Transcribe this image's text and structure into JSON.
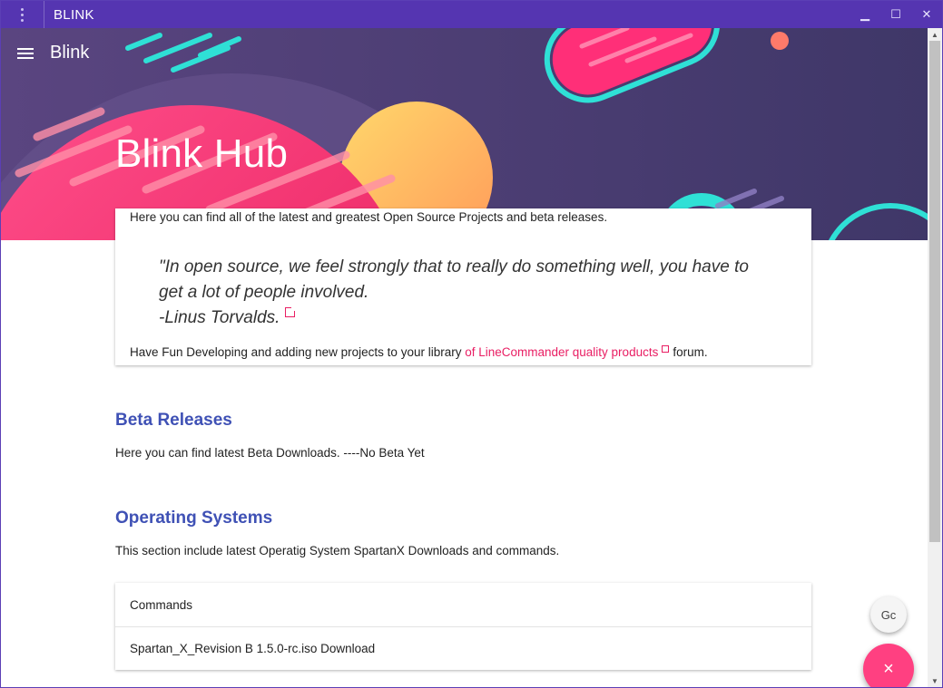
{
  "window": {
    "title": "BLINK",
    "minimize_glyph": "▁",
    "maximize_glyph": "☐",
    "close_glyph": "✕"
  },
  "nav": {
    "brand": "Blink"
  },
  "hero": {
    "title": "Blink Hub"
  },
  "intro": {
    "text": "Here you can find all of the latest and greatest Open Source Projects and beta releases.",
    "quote_line1": "\"In open source, we feel strongly that to really do something well, you have to",
    "quote_line2": "get a lot of people involved.",
    "quote_author": "-Linus Torvalds.",
    "closing_prefix": "Have Fun Developing and adding new projects to your library ",
    "closing_link": "of LineCommander quality products",
    "closing_suffix": "forum."
  },
  "beta": {
    "heading": "Beta Releases",
    "text": "Here you can find latest Beta Downloads. ----No Beta Yet"
  },
  "os": {
    "heading": "Operating Systems",
    "text": "This section include latest Operatig System SpartanX Downloads and commands.",
    "rows": [
      "Commands",
      "Spartan_X_Revision B 1.5.0-rc.iso Download"
    ]
  },
  "fab": {
    "small_label": "Gc",
    "main_glyph": "×"
  },
  "colors": {
    "titlebar": "#5535b1",
    "hero_bg": "#4a3a78",
    "accent_pink": "#e91e63",
    "heading_blue": "#3f51b5",
    "fab_pink": "#ff4081"
  }
}
